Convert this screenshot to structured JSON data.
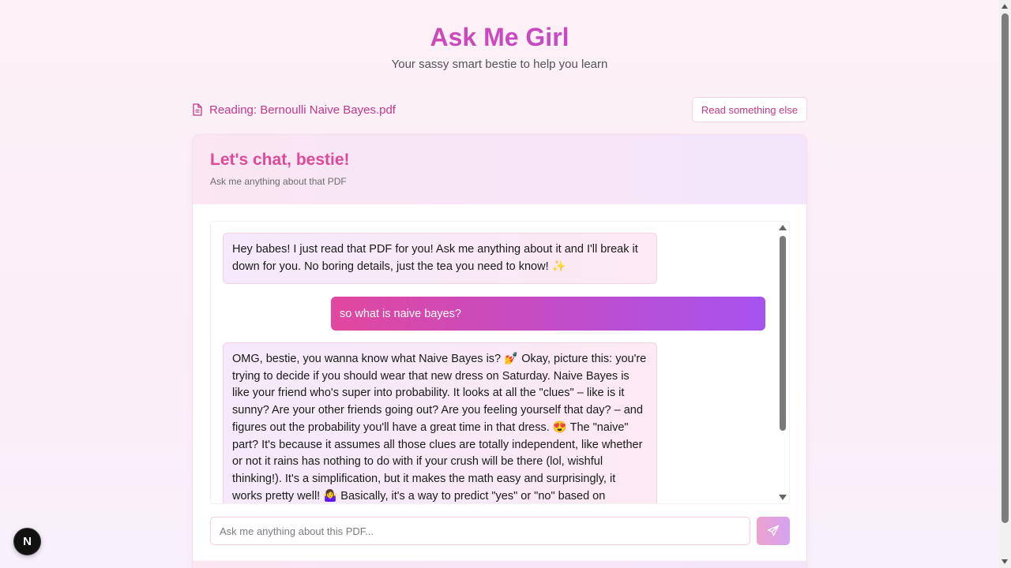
{
  "header": {
    "title": "Ask Me Girl",
    "subtitle": "Your sassy smart bestie to help you learn"
  },
  "reading": {
    "icon": "document-icon",
    "label": "Reading: Bernoulli Naive Bayes.pdf",
    "switch_button": "Read something else"
  },
  "chat": {
    "title": "Let's chat, bestie!",
    "subtitle": "Ask me anything about that PDF",
    "messages": [
      {
        "role": "assistant",
        "text": "Hey babes! I just read that PDF for you! Ask me anything about it and I'll break it down for you. No boring details, just the tea you need to know! ✨"
      },
      {
        "role": "user",
        "text": "so what is naive bayes?"
      },
      {
        "role": "assistant",
        "text": "OMG, bestie, you wanna know what Naive Bayes is? 💅 Okay, picture this: you're trying to decide if you should wear that new dress on Saturday. Naive Bayes is like your friend who's super into probability. It looks at all the \"clues\" – like is it sunny? Are your other friends going out? Are you feeling yourself that day? – and figures out the probability you'll have a great time in that dress. 😍 The \"naive\" part? It's because it assumes all those clues are totally independent, like whether or not it rains has nothing to do with if your crush will be there (lol, wishful thinking!). It's a simplification, but it makes the math easy and surprisingly, it works pretty well! 🤷‍♀️ Basically, it's a way to predict \"yes\" or \"no\" based on probabilities. The PDF"
      }
    ],
    "input_placeholder": "Ask me anything about this PDF...",
    "input_value": "",
    "send_icon": "send-icon"
  },
  "dev_badge": "N",
  "colors": {
    "accent_pink": "#e1479e",
    "accent_purple": "#a552ee",
    "title_pink": "#de4a97"
  }
}
